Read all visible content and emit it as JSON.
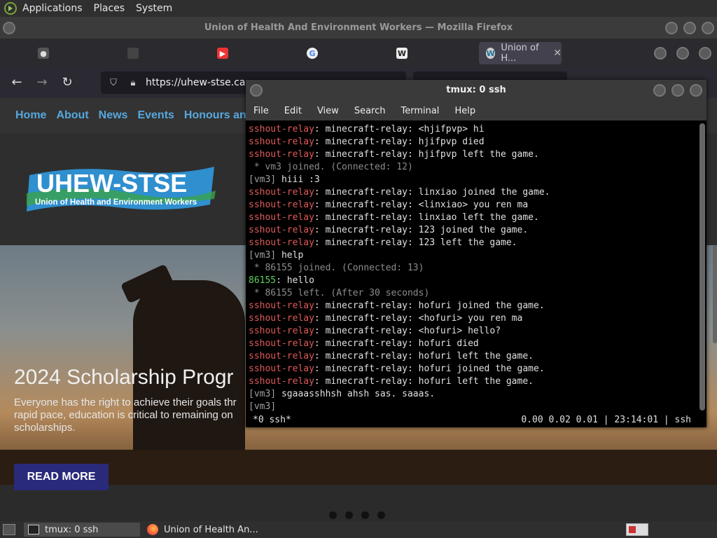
{
  "top_panel": {
    "menus": [
      "Applications",
      "Places",
      "System"
    ]
  },
  "firefox": {
    "window_title": "Union of Health And Environment Workers — Mozilla Firefox",
    "tabs": [
      {
        "label": "",
        "icon": "github-icon"
      },
      {
        "label": "",
        "icon": "generic-icon"
      },
      {
        "label": "",
        "icon": "youtube-icon"
      },
      {
        "label": "",
        "icon": "google-icon"
      },
      {
        "label": "",
        "icon": "wikipedia-icon"
      },
      {
        "label": "Union of H...",
        "icon": "wordpress-icon",
        "active": true
      }
    ],
    "url": "https://uhew-stse.ca"
  },
  "site": {
    "nav": [
      "Home",
      "About",
      "News",
      "Events",
      "Honours an"
    ],
    "logo_title": "UHEW-STSE",
    "logo_subtitle": "Union of Health and Environment Workers",
    "hero_title": "2024 Scholarship Progr",
    "hero_text": "Everyone has the right to achieve their goals thr rapid pace, education is critical to remaining on scholarships.",
    "read_more": "READ MORE"
  },
  "terminal": {
    "title": "tmux: 0 ssh",
    "menu": [
      "File",
      "Edit",
      "View",
      "Search",
      "Terminal",
      "Help"
    ],
    "lines": [
      {
        "prefix": "sshout-relay",
        "text": ": minecraft-relay: <hjifpvp> hi",
        "type": "relay"
      },
      {
        "prefix": "sshout-relay",
        "text": ": minecraft-relay: hjifpvp died",
        "type": "relay"
      },
      {
        "prefix": "sshout-relay",
        "text": ": minecraft-relay: hjifpvp left the game.",
        "type": "relay"
      },
      {
        "prefix": "",
        "text": " * vm3 joined. (Connected: 12)",
        "type": "join"
      },
      {
        "prefix": "[vm3]",
        "text": " hiii :3",
        "type": "vm3"
      },
      {
        "prefix": "sshout-relay",
        "text": ": minecraft-relay: linxiao joined the game.",
        "type": "relay"
      },
      {
        "prefix": "sshout-relay",
        "text": ": minecraft-relay: <linxiao> you ren ma",
        "type": "relay"
      },
      {
        "prefix": "sshout-relay",
        "text": ": minecraft-relay: linxiao left the game.",
        "type": "relay"
      },
      {
        "prefix": "sshout-relay",
        "text": ": minecraft-relay: 123 joined the game.",
        "type": "relay"
      },
      {
        "prefix": "sshout-relay",
        "text": ": minecraft-relay: 123 left the game.",
        "type": "relay"
      },
      {
        "prefix": "[vm3]",
        "text": " help",
        "type": "vm3"
      },
      {
        "prefix": "",
        "text": " * 86155 joined. (Connected: 13)",
        "type": "join"
      },
      {
        "prefix": "86155",
        "text": ": hello",
        "type": "green"
      },
      {
        "prefix": "",
        "text": " * 86155 left. (After 30 seconds)",
        "type": "join"
      },
      {
        "prefix": "sshout-relay",
        "text": ": minecraft-relay: hofuri joined the game.",
        "type": "relay"
      },
      {
        "prefix": "sshout-relay",
        "text": ": minecraft-relay: <hofuri> you ren ma",
        "type": "relay"
      },
      {
        "prefix": "sshout-relay",
        "text": ": minecraft-relay: <hofuri> hello?",
        "type": "relay"
      },
      {
        "prefix": "sshout-relay",
        "text": ": minecraft-relay: hofuri died",
        "type": "relay"
      },
      {
        "prefix": "sshout-relay",
        "text": ": minecraft-relay: hofuri left the game.",
        "type": "relay"
      },
      {
        "prefix": "sshout-relay",
        "text": ": minecraft-relay: hofuri joined the game.",
        "type": "relay"
      },
      {
        "prefix": "sshout-relay",
        "text": ": minecraft-relay: hofuri left the game.",
        "type": "relay"
      },
      {
        "prefix": "[vm3]",
        "text": " sgaaasshhsh ahsh sas. saaas.",
        "type": "vm3"
      },
      {
        "prefix": "[vm3]",
        "text": "",
        "type": "vm3"
      }
    ],
    "status_left": "*0 ssh*",
    "status_right": "0.00 0.02 0.01 | 23:14:01 | ssh"
  },
  "taskbar": {
    "items": [
      {
        "label": "tmux: 0 ssh",
        "active": true
      },
      {
        "label": "Union of Health An...",
        "active": false
      }
    ]
  },
  "colors": {
    "relay": "#e05a5a",
    "vm3": "#a0a0a0",
    "join": "#8c8c8c",
    "green": "#5fcf5f",
    "link": "#56a8de",
    "button": "#2a2a7a"
  }
}
